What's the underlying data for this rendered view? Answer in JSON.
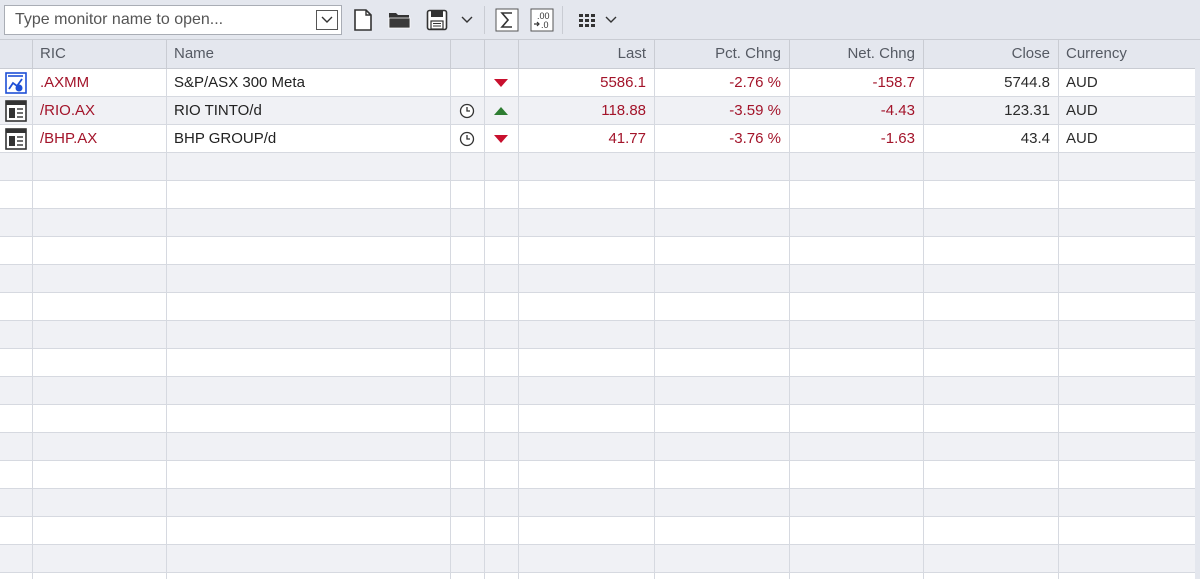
{
  "toolbar": {
    "monitor_placeholder": "Type monitor name to open...",
    "icons": [
      "chevron-down-icon",
      "new-document-icon",
      "open-folder-icon",
      "save-icon",
      "chevron-down-icon",
      "sum-icon",
      "decimal-format-icon",
      "grid-layout-icon",
      "chevron-down-icon"
    ]
  },
  "columns": {
    "ric": "RIC",
    "name": "Name",
    "last": "Last",
    "pct_chng": "Pct. Chng",
    "net_chng": "Net. Chng",
    "close": "Close",
    "currency": "Currency"
  },
  "rows": [
    {
      "icon": "index-chart-icon",
      "ric": ".AXMM",
      "name": "S&P/ASX 300 Meta",
      "delayed": false,
      "direction": "down",
      "last": "5586.1",
      "pct_chng": "-2.76 %",
      "net_chng": "-158.7",
      "close": "5744.8",
      "currency": "AUD"
    },
    {
      "icon": "quote-page-icon",
      "ric": "/RIO.AX",
      "name": "RIO TINTO/d",
      "delayed": true,
      "direction": "up",
      "last": "118.88",
      "pct_chng": "-3.59 %",
      "net_chng": "-4.43",
      "close": "123.31",
      "currency": "AUD"
    },
    {
      "icon": "quote-page-icon",
      "ric": "/BHP.AX",
      "name": "BHP GROUP/d",
      "delayed": true,
      "direction": "down",
      "last": "41.77",
      "pct_chng": "-3.76 %",
      "net_chng": "-1.63",
      "close": "43.4",
      "currency": "AUD"
    }
  ],
  "empty_row_count": 15,
  "colors": {
    "negative": "#a3142a",
    "up_arrow": "#2e7d32",
    "down_arrow": "#c8102e",
    "header_bg": "#e4e7ee",
    "stripe": "#f0f1f5"
  }
}
